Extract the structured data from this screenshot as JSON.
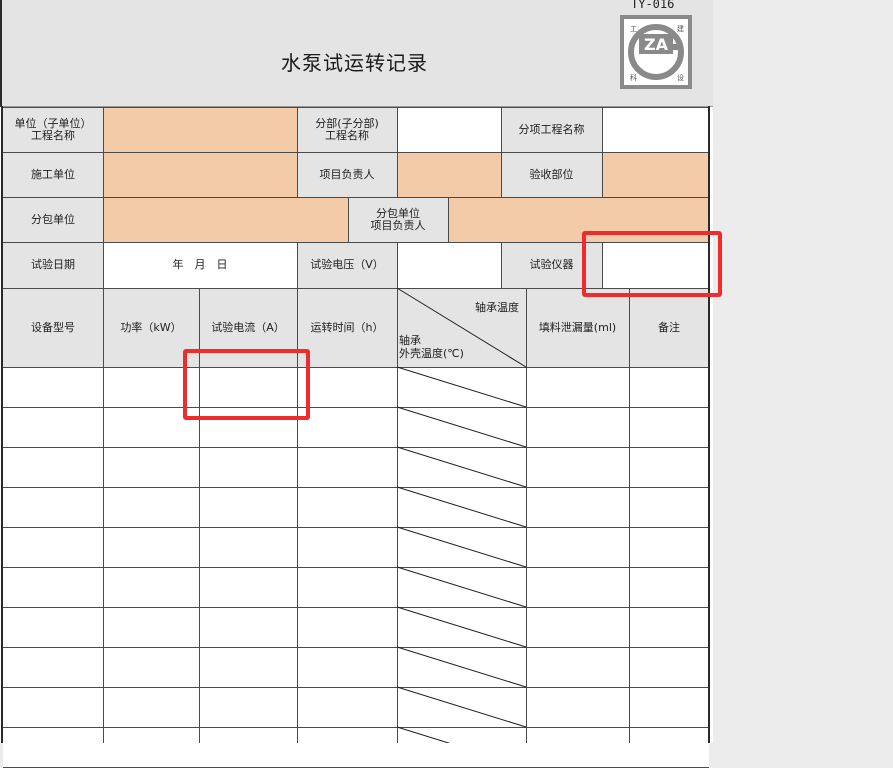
{
  "header": {
    "title": "水泵试运转记录",
    "form_code": "TY-016",
    "logo": {
      "letters": "ZA",
      "corner_tl": "工",
      "corner_tr": "建",
      "corner_bl": "科",
      "corner_br": "设"
    }
  },
  "form": {
    "row1": {
      "unit_label_1": "单位（子单位）",
      "unit_label_2": "工程名称",
      "part_label_1": "分部(子分部)",
      "part_label_2": "工程名称",
      "item_label": "分项工程名称"
    },
    "row2": {
      "contractor_label": "施工单位",
      "manager_label": "项目负责人",
      "acceptance_label": "验收部位"
    },
    "row3": {
      "sub_label": "分包单位",
      "sub_manager_label_1": "分包单位",
      "sub_manager_label_2": "项目负责人"
    },
    "row4": {
      "date_label": "试验日期",
      "date_value": "年　月　日",
      "voltage_label": "试验电压（V）",
      "instrument_label": "试验仪器"
    },
    "table_header": {
      "model": "设备型号",
      "power": "功率（kW）",
      "current": "试验电流（A）",
      "runtime": "运转时间（h）",
      "bearing_temp": "轴承温度",
      "bearing_label_1": "轴承",
      "bearing_label_2": "外壳温度(℃)",
      "leakage": "填料泄漏量(ml)",
      "remarks": "备注"
    }
  },
  "colors": {
    "label_bg": "#e4e4e4",
    "input_bg": "#f3cba8",
    "highlight": "#ee2c2c"
  }
}
